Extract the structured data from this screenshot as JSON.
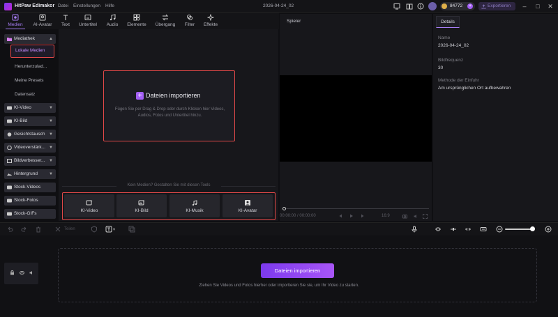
{
  "titlebar": {
    "app_name": "HitPaw Edimakor",
    "menu": [
      "Datei",
      "Einstellungen",
      "Hilfe"
    ],
    "project_name": "2026-04-24_02",
    "coins": "84772",
    "export_label": "Exportieren"
  },
  "toolbar": {
    "tabs": [
      {
        "label": "Medien",
        "icon": "media-icon"
      },
      {
        "label": "AI-Avatar",
        "icon": "avatar-icon"
      },
      {
        "label": "Text",
        "icon": "text-icon"
      },
      {
        "label": "Untertitel",
        "icon": "subtitle-icon"
      },
      {
        "label": "Audio",
        "icon": "audio-icon"
      },
      {
        "label": "Elemente",
        "icon": "elements-icon"
      },
      {
        "label": "Übergang",
        "icon": "transition-icon"
      },
      {
        "label": "Filter",
        "icon": "filter-icon"
      },
      {
        "label": "Effekte",
        "icon": "effects-icon"
      }
    ],
    "active": "Medien"
  },
  "sidebar": {
    "media_library": "Mediathek",
    "sub_items": [
      "Lokale Medien",
      "Herunterzulad...",
      "Meine Presets",
      "Datensatz"
    ],
    "selected": "Lokale Medien",
    "groups": [
      "KI-Video",
      "KI-Bild",
      "Gesichtstausch",
      "Videoverstärk...",
      "Bildverbesser...",
      "Hintergrund",
      "Stock-Videos",
      "Stock-Fotos",
      "Stock-GIFs"
    ]
  },
  "media": {
    "import_label": "Dateien importieren",
    "import_desc": "Fügen Sie per Drag & Drop oder durch Klicken hier Videos, Audios, Fotos und Untertitel hinzu.",
    "tools_hint": "Kein Medien? Gestalten Sie mit diesen Tools",
    "tools": [
      "KI-Video",
      "KI-Bild",
      "KI-Musik",
      "KI-Avatar"
    ]
  },
  "player": {
    "title": "Spieler",
    "time": "00:00:00 / 00:00:00",
    "ratio": "16:9"
  },
  "details": {
    "tab": "Details",
    "name_label": "Name",
    "name_value": "2026-04-24_02",
    "fps_label": "Bildfrequenz",
    "fps_value": "30",
    "import_method_label": "Methode der Einfuhr",
    "import_method_value": "Am ursprünglichen Ort aufbewahren"
  },
  "timeline": {
    "split_label": "Teilen",
    "import_label": "Dateien importieren",
    "hint": "Ziehen Sie Videos und Fotos hierher oder importieren Sie sie, um Ihr Video zu starten."
  },
  "colors": {
    "accent": "#a87ef7",
    "highlight_border": "#e04848",
    "background": "#0f0f12"
  }
}
